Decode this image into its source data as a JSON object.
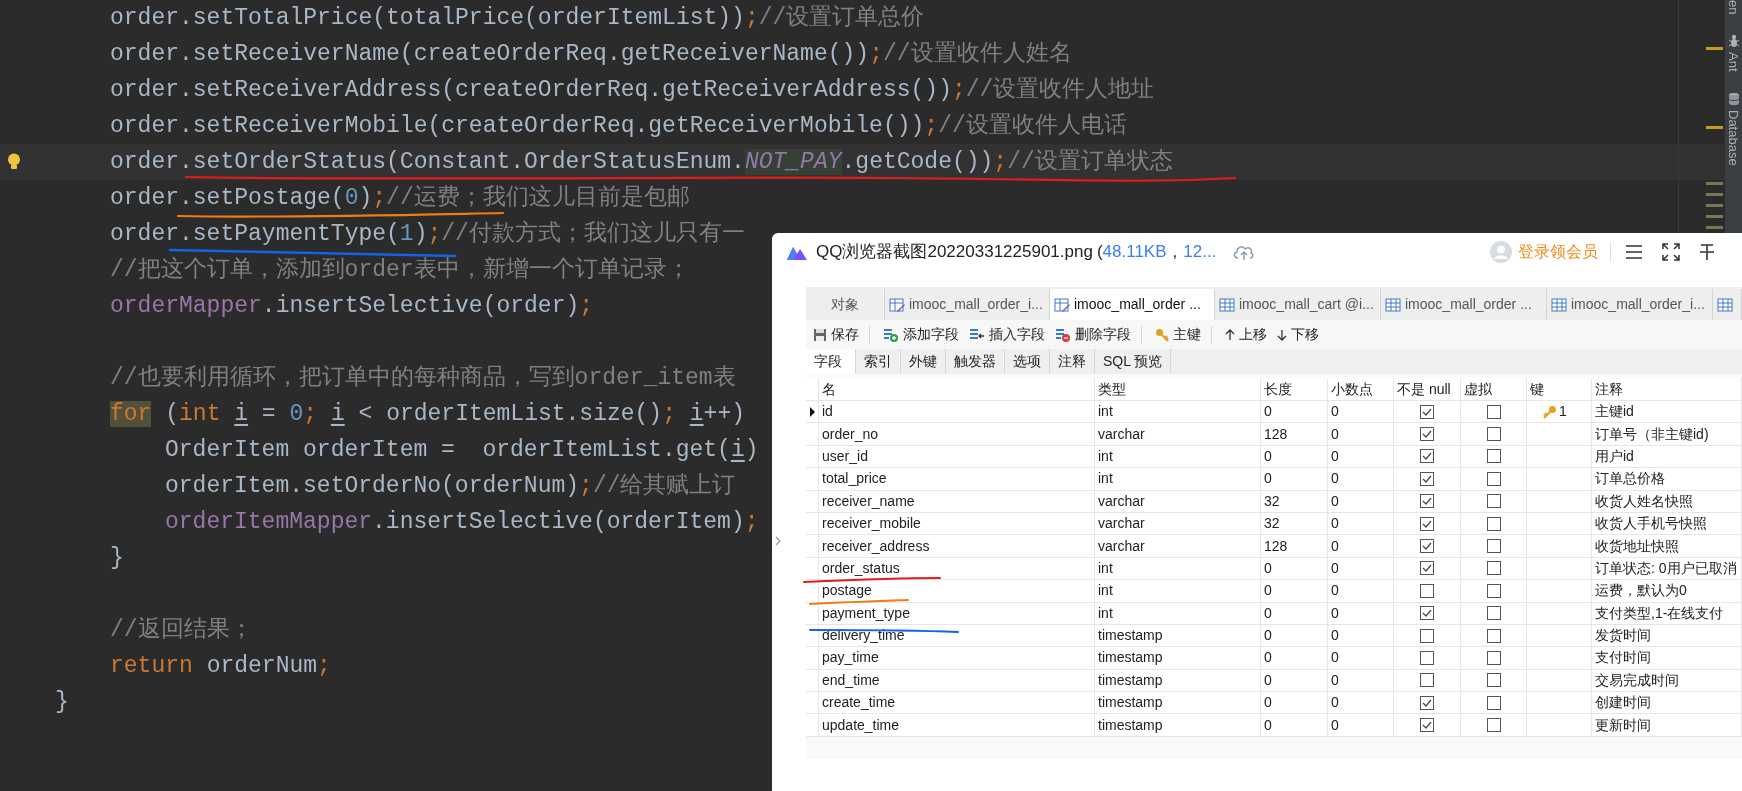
{
  "editor": {
    "lines": [
      {
        "kind": "group",
        "children": [
          {
            "kind": "code",
            "current": false,
            "tokens": [
              {
                "kind": "plain",
                "text": "order.setTotalPrice(totalPrice(orderItemList))"
              },
              {
                "kind": "semi",
                "text": ";"
              },
              {
                "kind": "comment",
                "text": "//设置订单总价"
              }
            ]
          },
          {
            "kind": "code",
            "current": false,
            "tokens": [
              {
                "kind": "plain",
                "text": "order.setReceiverName(createOrderReq.getReceiverName())"
              },
              {
                "kind": "semi",
                "text": ";"
              },
              {
                "kind": "comment",
                "text": "//设置收件人姓名"
              }
            ]
          },
          {
            "kind": "code",
            "current": false,
            "tokens": [
              {
                "kind": "plain",
                "text": "order.setReceiverAddress(createOrderReq.getReceiverAddress())"
              },
              {
                "kind": "semi",
                "text": ";"
              },
              {
                "kind": "comment",
                "text": "//设置收件人地址"
              }
            ]
          },
          {
            "kind": "code",
            "current": false,
            "tokens": [
              {
                "kind": "plain",
                "text": "order.setReceiverMobile(createOrderReq.getReceiverMobile())"
              },
              {
                "kind": "semi",
                "text": ";"
              },
              {
                "kind": "comment",
                "text": "//设置收件人电话"
              }
            ]
          },
          {
            "kind": "code",
            "current": true,
            "tokens": [
              {
                "kind": "plain",
                "text": "order.setOrderStatus(Constant.OrderStatusEnum."
              },
              {
                "kind": "constant_marked",
                "text": "NOT_PAY"
              },
              {
                "kind": "plain",
                "text": ".getCode())"
              },
              {
                "kind": "semi",
                "text": ";"
              },
              {
                "kind": "comment",
                "text": "//设置订单状态"
              }
            ]
          },
          {
            "kind": "code",
            "current": false,
            "tokens": [
              {
                "kind": "plain",
                "text": "order.setPostage("
              },
              {
                "kind": "number",
                "text": "0"
              },
              {
                "kind": "plain",
                "text": ")"
              },
              {
                "kind": "semi",
                "text": ";"
              },
              {
                "kind": "comment",
                "text": "//运费；我们这儿目前是包邮"
              }
            ]
          },
          {
            "kind": "code",
            "current": false,
            "tokens": [
              {
                "kind": "plain",
                "text": "order.setPaymentType("
              },
              {
                "kind": "number",
                "text": "1"
              },
              {
                "kind": "plain",
                "text": ")"
              },
              {
                "kind": "semi",
                "text": ";"
              },
              {
                "kind": "comment",
                "text": "//付款方式；我们这儿只有一"
              }
            ]
          },
          {
            "kind": "code",
            "current": false,
            "tokens": [
              {
                "kind": "comment",
                "text": "//把这个订单，添加到order表中，新增一个订单记录；"
              }
            ]
          },
          {
            "kind": "code",
            "current": false,
            "tokens": [
              {
                "kind": "field",
                "text": "orderMapper"
              },
              {
                "kind": "plain",
                "text": ".insertSelective(order)"
              },
              {
                "kind": "semi",
                "text": ";"
              }
            ]
          },
          {
            "kind": "blank"
          },
          {
            "kind": "code",
            "current": false,
            "tokens": [
              {
                "kind": "comment",
                "text": "//也要利用循环，把订单中的每种商品，写到order_item表"
              }
            ]
          },
          {
            "kind": "code",
            "current": false,
            "tokens": [
              {
                "kind": "keyword_marked",
                "text": "for"
              },
              {
                "kind": "plain",
                "text": " ("
              },
              {
                "kind": "keyword",
                "text": "int "
              },
              {
                "kind": "local",
                "text": "i"
              },
              {
                "kind": "plain",
                "text": " = "
              },
              {
                "kind": "number",
                "text": "0"
              },
              {
                "kind": "semi",
                "text": "; "
              },
              {
                "kind": "local",
                "text": "i"
              },
              {
                "kind": "plain",
                "text": " < orderItemList.size()"
              },
              {
                "kind": "semi",
                "text": "; "
              },
              {
                "kind": "local",
                "text": "i"
              },
              {
                "kind": "plain",
                "text": "++)"
              }
            ],
            "children": [
              {
                "kind": "code",
                "current": false,
                "tokens": [
                  {
                    "kind": "plain",
                    "text": "OrderItem orderItem =  orderItemList.get("
                  },
                  {
                    "kind": "local",
                    "text": "i"
                  },
                  {
                    "kind": "plain",
                    "text": ")"
                  }
                ]
              },
              {
                "kind": "code",
                "current": false,
                "tokens": [
                  {
                    "kind": "plain",
                    "text": "orderItem.setOrderNo(orderNum)"
                  },
                  {
                    "kind": "semi",
                    "text": ";"
                  },
                  {
                    "kind": "comment",
                    "text": "//给其赋上订"
                  }
                ]
              },
              {
                "kind": "code",
                "current": false,
                "tokens": [
                  {
                    "kind": "field",
                    "text": "orderItemMapper"
                  },
                  {
                    "kind": "plain",
                    "text": ".insertSelective(orderItem)"
                  },
                  {
                    "kind": "semi",
                    "text": ";"
                  }
                ]
              }
            ]
          },
          {
            "kind": "code",
            "current": false,
            "tokens": [
              {
                "kind": "plain",
                "text": "}"
              }
            ]
          },
          {
            "kind": "blank"
          },
          {
            "kind": "code",
            "current": false,
            "tokens": [
              {
                "kind": "comment",
                "text": "//返回结果；"
              }
            ]
          },
          {
            "kind": "code",
            "current": false,
            "tokens": [
              {
                "kind": "keyword",
                "text": "return "
              },
              {
                "kind": "plain",
                "text": "orderNum"
              },
              {
                "kind": "semi",
                "text": ";"
              }
            ]
          }
        ]
      },
      {
        "kind": "code",
        "current": false,
        "tokens": [
          {
            "kind": "plain",
            "text": "}"
          }
        ]
      }
    ]
  },
  "tool_strip": {
    "items": [
      {
        "kind": "partial",
        "label": "en"
      },
      {
        "kind": "ant",
        "label": "Ant"
      },
      {
        "kind": "database",
        "label": "Database"
      }
    ]
  },
  "viewer": {
    "file_name": "QQ浏览器截图20220331225901.png",
    "open_paren": "(",
    "file_size": "48.11KB",
    "separator": ",",
    "dimensions": "12...",
    "login": "登录领会员"
  },
  "navicat": {
    "tabs": [
      {
        "kind": "object",
        "label": "对象",
        "selected": false
      },
      {
        "kind": "design",
        "label": "imooc_mall_order_i...",
        "selected": false
      },
      {
        "kind": "design",
        "label": "imooc_mall_order ...",
        "selected": true
      },
      {
        "kind": "table",
        "label": "imooc_mall_cart @i...",
        "selected": false
      },
      {
        "kind": "table",
        "label": "imooc_mall_order ...",
        "selected": false
      },
      {
        "kind": "table",
        "label": "imooc_mall_order_i...",
        "selected": false
      },
      {
        "kind": "table",
        "selected": false
      }
    ],
    "toolbar": [
      {
        "kind": "save",
        "label": "保存"
      },
      {
        "kind": "add",
        "label": "添加字段"
      },
      {
        "kind": "insert",
        "label": "插入字段"
      },
      {
        "kind": "delete",
        "label": "删除字段"
      },
      {
        "kind": "key",
        "label": "主键"
      },
      {
        "kind": "up",
        "label": "上移"
      },
      {
        "kind": "down",
        "label": "下移"
      }
    ],
    "subtabs": [
      {
        "label": "字段",
        "selected": true
      },
      {
        "label": "索引",
        "selected": false
      },
      {
        "label": "外键",
        "selected": false
      },
      {
        "label": "触发器",
        "selected": false
      },
      {
        "label": "选项",
        "selected": false
      },
      {
        "label": "注释",
        "selected": false
      },
      {
        "label": "SQL 预览",
        "selected": false
      }
    ],
    "table": {
      "columns": [
        "名",
        "类型",
        "长度",
        "小数点",
        "不是 null",
        "虚拟",
        "键",
        "注释"
      ],
      "rows": [
        {
          "current": true,
          "name": "id",
          "type": "int",
          "length": "0",
          "decimals": "0",
          "not_null": true,
          "virtual": false,
          "key": "1",
          "comment": "主键id"
        },
        {
          "current": false,
          "name": "order_no",
          "type": "varchar",
          "length": "128",
          "decimals": "0",
          "not_null": true,
          "virtual": false,
          "comment": "订单号（非主键id)"
        },
        {
          "current": false,
          "name": "user_id",
          "type": "int",
          "length": "0",
          "decimals": "0",
          "not_null": true,
          "virtual": false,
          "comment": "用户id"
        },
        {
          "current": false,
          "name": "total_price",
          "type": "int",
          "length": "0",
          "decimals": "0",
          "not_null": true,
          "virtual": false,
          "comment": "订单总价格"
        },
        {
          "current": false,
          "name": "receiver_name",
          "type": "varchar",
          "length": "32",
          "decimals": "0",
          "not_null": true,
          "virtual": false,
          "comment": "收货人姓名快照"
        },
        {
          "current": false,
          "name": "receiver_mobile",
          "type": "varchar",
          "length": "32",
          "decimals": "0",
          "not_null": true,
          "virtual": false,
          "comment": "收货人手机号快照"
        },
        {
          "current": false,
          "name": "receiver_address",
          "type": "varchar",
          "length": "128",
          "decimals": "0",
          "not_null": true,
          "virtual": false,
          "comment": "收货地址快照"
        },
        {
          "current": false,
          "name": "order_status",
          "type": "int",
          "length": "0",
          "decimals": "0",
          "not_null": true,
          "virtual": false,
          "comment": "订单状态: 0用户已取消"
        },
        {
          "current": false,
          "name": "postage",
          "type": "int",
          "length": "0",
          "decimals": "0",
          "not_null": false,
          "virtual": false,
          "comment": "运费，默认为0"
        },
        {
          "current": false,
          "name": "payment_type",
          "type": "int",
          "length": "0",
          "decimals": "0",
          "not_null": true,
          "virtual": false,
          "comment": "支付类型,1-在线支付"
        },
        {
          "current": false,
          "name": "delivery_time",
          "type": "timestamp",
          "length": "0",
          "decimals": "0",
          "not_null": false,
          "virtual": false,
          "comment": "发货时间"
        },
        {
          "current": false,
          "name": "pay_time",
          "type": "timestamp",
          "length": "0",
          "decimals": "0",
          "not_null": false,
          "virtual": false,
          "comment": "支付时间"
        },
        {
          "current": false,
          "name": "end_time",
          "type": "timestamp",
          "length": "0",
          "decimals": "0",
          "not_null": false,
          "virtual": false,
          "comment": "交易完成时间"
        },
        {
          "current": false,
          "name": "create_time",
          "type": "timestamp",
          "length": "0",
          "decimals": "0",
          "not_null": true,
          "virtual": false,
          "comment": "创建时间"
        },
        {
          "current": false,
          "name": "update_time",
          "type": "timestamp",
          "length": "0",
          "decimals": "0",
          "not_null": true,
          "virtual": false,
          "comment": "更新时间"
        }
      ]
    }
  }
}
